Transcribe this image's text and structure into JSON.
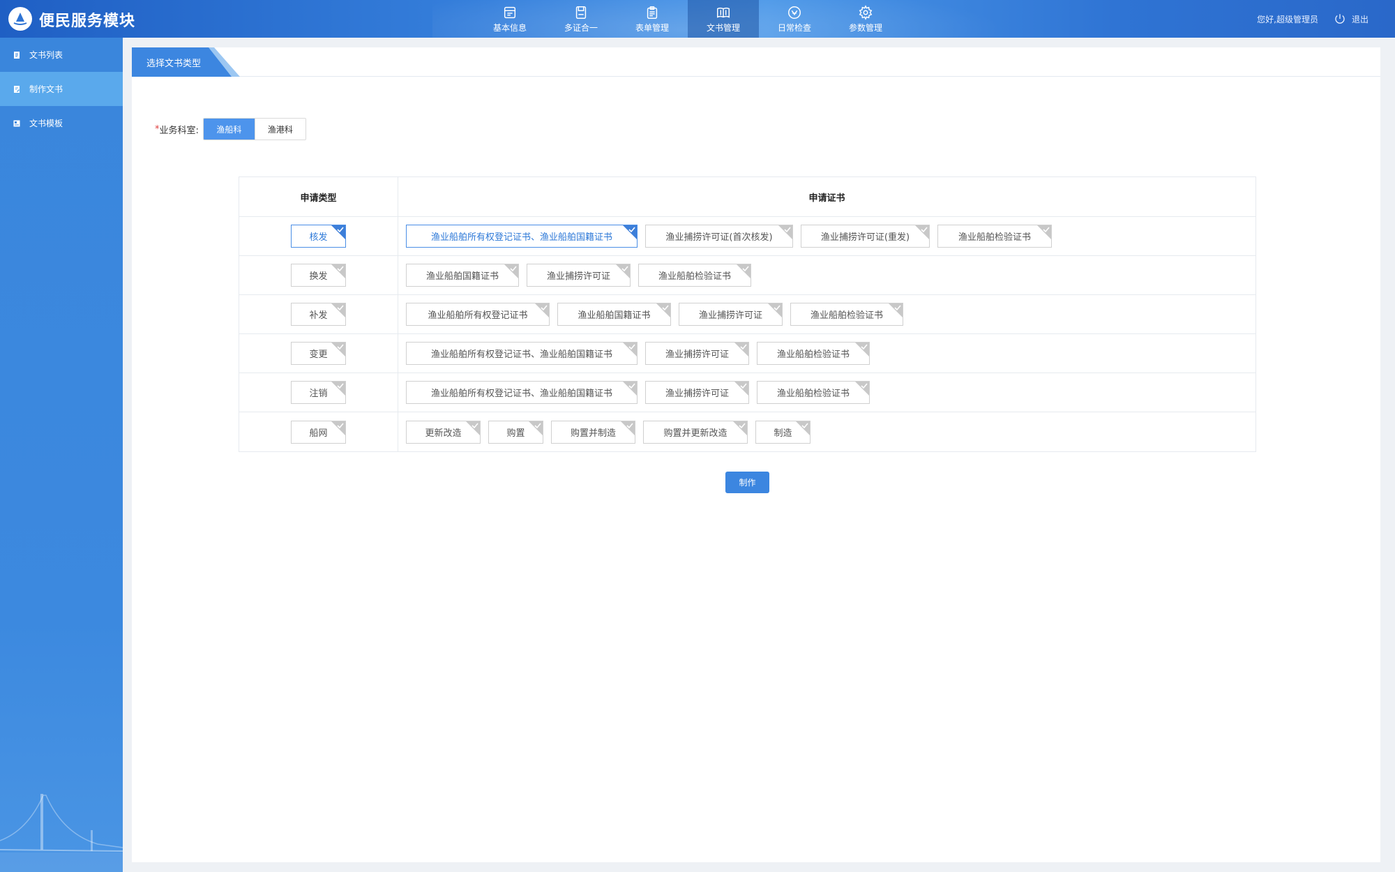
{
  "header": {
    "app_title": "便民服务模块",
    "nav": [
      {
        "label": "基本信息",
        "icon": "calendar-icon"
      },
      {
        "label": "多证合一",
        "icon": "save-disk-icon"
      },
      {
        "label": "表单管理",
        "icon": "clipboard-icon"
      },
      {
        "label": "文书管理",
        "icon": "book-icon"
      },
      {
        "label": "日常检查",
        "icon": "compass-icon"
      },
      {
        "label": "参数管理",
        "icon": "gear-icon"
      }
    ],
    "active_nav": "文书管理",
    "greeting": "您好,超级管理员",
    "logout": "退出"
  },
  "sidebar": {
    "items": [
      {
        "label": "文书列表",
        "icon": "document-icon"
      },
      {
        "label": "制作文书",
        "icon": "edit-document-icon"
      },
      {
        "label": "文书模板",
        "icon": "template-icon"
      }
    ],
    "active": "制作文书"
  },
  "panel": {
    "tab_title": "选择文书类型",
    "dept_label": "业务科室:",
    "dept_required_mark": "*",
    "dept_options": [
      "渔船科",
      "渔港科"
    ],
    "dept_selected": "渔船科",
    "table": {
      "col_type": "申请类型",
      "col_cert": "申请证书",
      "rows": [
        {
          "type": "核发",
          "type_checked": true,
          "certs": [
            {
              "label": "渔业船舶所有权登记证书、渔业船舶国籍证书",
              "checked": true
            },
            {
              "label": "渔业捕捞许可证(首次核发)",
              "checked": false
            },
            {
              "label": "渔业捕捞许可证(重发)",
              "checked": false
            },
            {
              "label": "渔业船舶检验证书",
              "checked": false
            }
          ]
        },
        {
          "type": "换发",
          "type_checked": false,
          "certs": [
            {
              "label": "渔业船舶国籍证书",
              "checked": false
            },
            {
              "label": "渔业捕捞许可证",
              "checked": false
            },
            {
              "label": "渔业船舶检验证书",
              "checked": false
            }
          ]
        },
        {
          "type": "补发",
          "type_checked": false,
          "certs": [
            {
              "label": "渔业船舶所有权登记证书",
              "checked": false
            },
            {
              "label": "渔业船舶国籍证书",
              "checked": false
            },
            {
              "label": "渔业捕捞许可证",
              "checked": false
            },
            {
              "label": "渔业船舶检验证书",
              "checked": false
            }
          ]
        },
        {
          "type": "变更",
          "type_checked": false,
          "certs": [
            {
              "label": "渔业船舶所有权登记证书、渔业船舶国籍证书",
              "checked": false
            },
            {
              "label": "渔业捕捞许可证",
              "checked": false
            },
            {
              "label": "渔业船舶检验证书",
              "checked": false
            }
          ]
        },
        {
          "type": "注销",
          "type_checked": false,
          "certs": [
            {
              "label": "渔业船舶所有权登记证书、渔业船舶国籍证书",
              "checked": false
            },
            {
              "label": "渔业捕捞许可证",
              "checked": false
            },
            {
              "label": "渔业船舶检验证书",
              "checked": false
            }
          ]
        },
        {
          "type": "船网",
          "type_checked": false,
          "certs": [
            {
              "label": "更新改造",
              "checked": false
            },
            {
              "label": "购置",
              "checked": false
            },
            {
              "label": "购置并制造",
              "checked": false
            },
            {
              "label": "购置并更新改造",
              "checked": false
            },
            {
              "label": "制造",
              "checked": false
            }
          ]
        }
      ]
    },
    "make_button": "制作"
  },
  "colors": {
    "primary": "#3c86e0",
    "selected_border": "#4a8ee6",
    "sidebar_active": "#5aa9ec",
    "corner_unchecked": "#c8c8c8",
    "corner_checked": "#3d7fd9"
  }
}
